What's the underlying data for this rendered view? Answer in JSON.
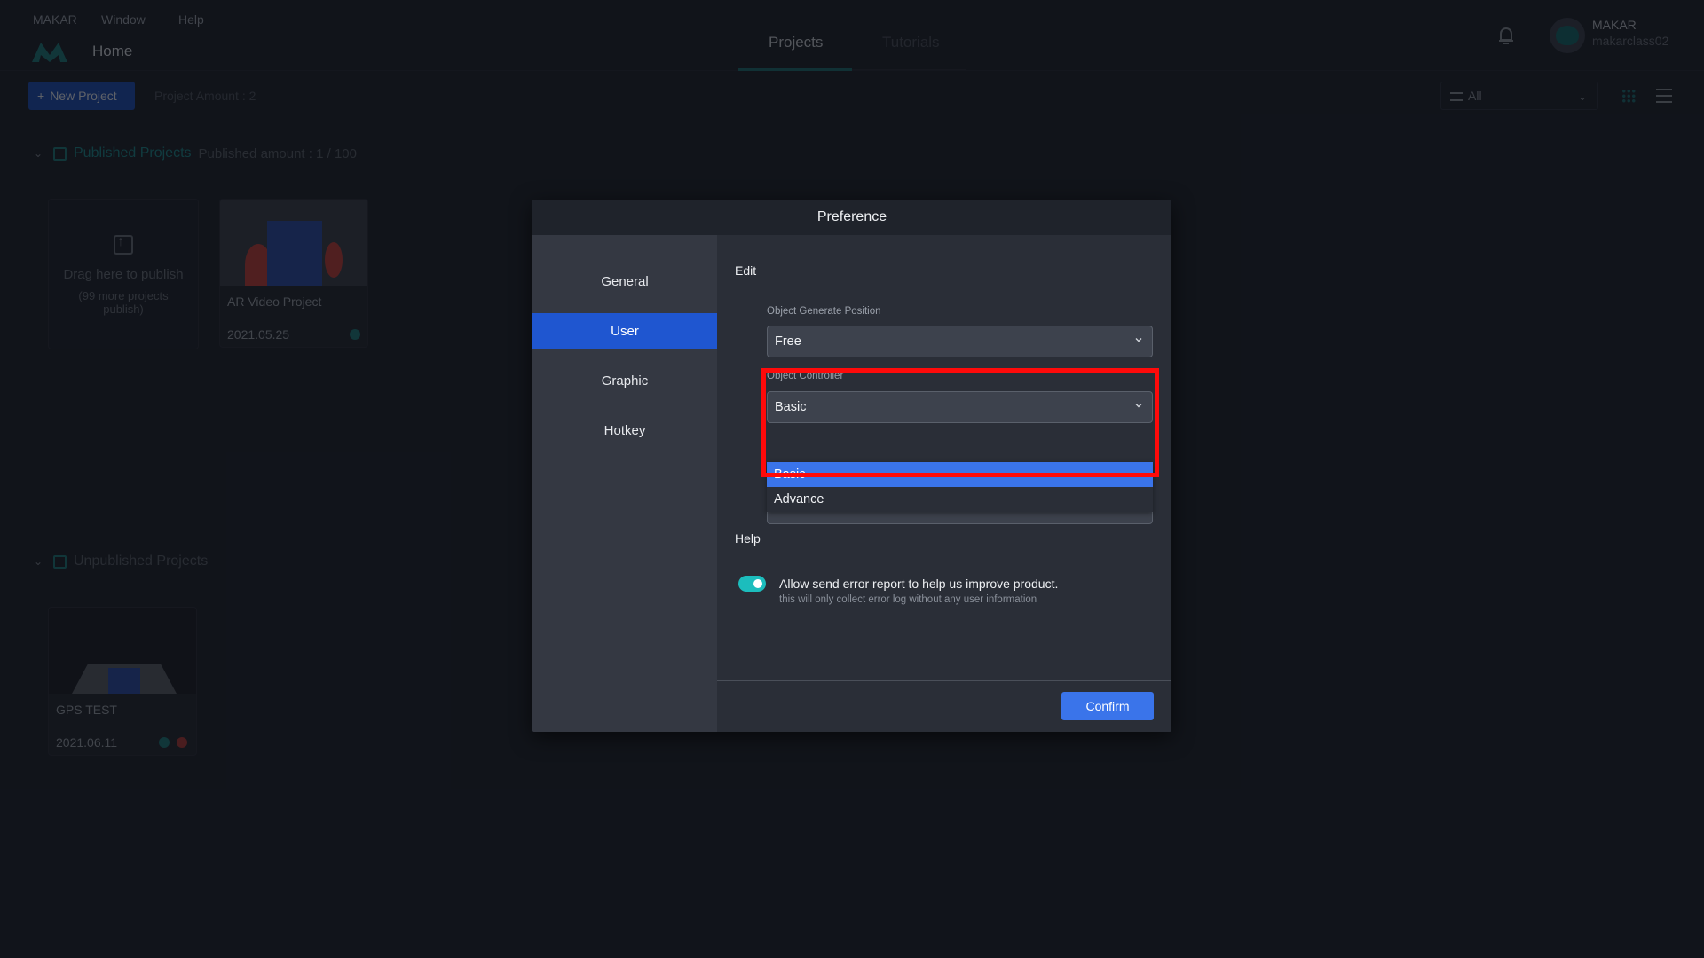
{
  "app": {
    "menu": [
      "MAKAR",
      "Window",
      "Help"
    ],
    "page_title": "Home",
    "tabs": [
      {
        "label": "Projects",
        "active": true
      },
      {
        "label": "Tutorials",
        "active": false
      }
    ],
    "user": {
      "name": "MAKAR",
      "id": "makarclass02"
    },
    "toolbar": {
      "new_project_label": "New Project",
      "new_project_icon": "plus-icon",
      "project_amount": "Project Amount : 2",
      "filter_value": "All"
    },
    "published": {
      "title": "Published Projects",
      "subtitle": "Published amount : 1 / 100",
      "drop_zone": {
        "title": "Drag here to publish",
        "subtitle": "(99 more projects publish)"
      },
      "projects": [
        {
          "name": "AR Video Project",
          "date": "2021.05.25"
        }
      ]
    },
    "unpublished": {
      "title": "Unpublished Projects",
      "projects": [
        {
          "name": "GPS TEST",
          "date": "2021.06.11"
        }
      ]
    }
  },
  "dialog": {
    "title": "Preference",
    "sidebar": [
      {
        "label": "General",
        "active": false
      },
      {
        "label": "User",
        "active": true
      },
      {
        "label": "Graphic",
        "active": false
      },
      {
        "label": "Hotkey",
        "active": false
      }
    ],
    "edit": {
      "label": "Edit",
      "object_generate_position": {
        "label": "Object Generate Position",
        "value": "Free"
      },
      "object_controller": {
        "label": "Object Controller",
        "value": "Basic",
        "options": [
          "Basic",
          "Advance"
        ],
        "highlighted_option": "Basic"
      }
    },
    "help": {
      "label": "Help",
      "error_report": {
        "enabled": true,
        "text": "Allow send error report to help us improve product.",
        "subtext": "this will only collect error log without any user information"
      }
    },
    "confirm_label": "Confirm"
  },
  "colors": {
    "accent_blue": "#3a74ea",
    "sidebar_active": "#1f56d0",
    "toggle_on": "#1cbdbd",
    "highlight_red": "#ff0a0a",
    "brand_teal": "#1d8a8b"
  }
}
